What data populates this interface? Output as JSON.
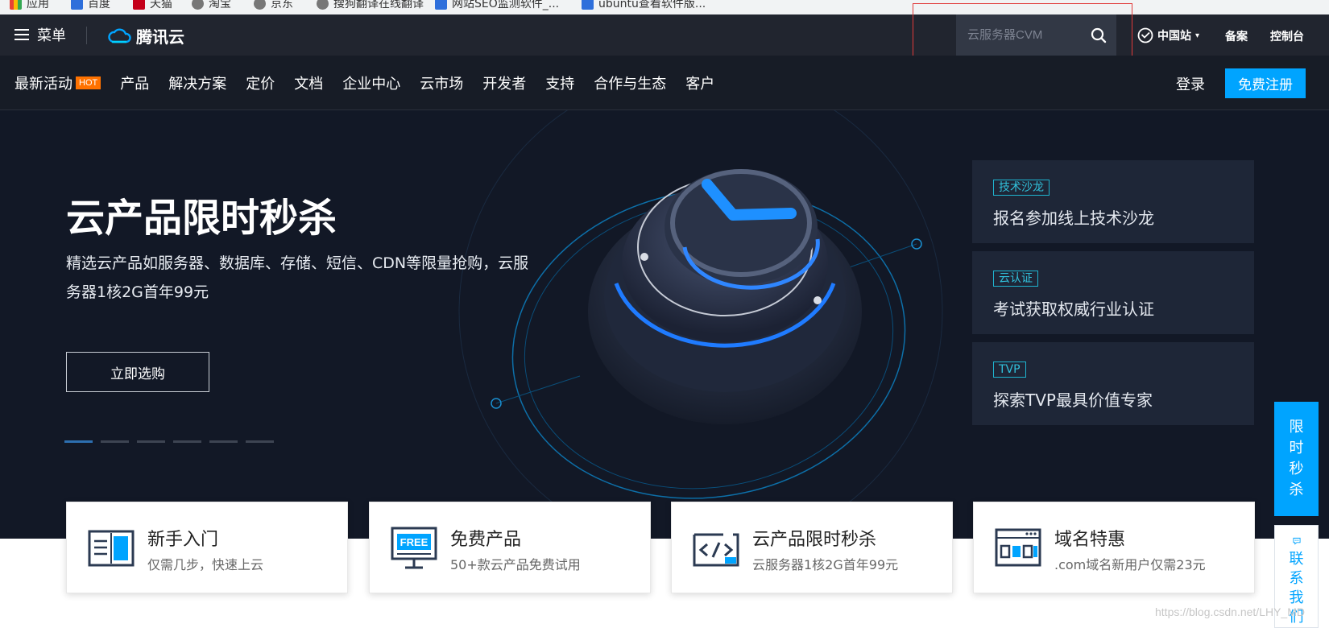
{
  "bookmarks": [
    "应用",
    "百度",
    "天猫",
    "淘宝",
    "京东",
    "搜狗翻译在线翻译",
    "网站SEO监测软件_...",
    "ubuntu查看软件版..."
  ],
  "topbar": {
    "menu_label": "菜单",
    "logo_text": "腾讯云",
    "search_placeholder": "云服务器CVM",
    "region": "中国站",
    "links": [
      "备案",
      "控制台"
    ]
  },
  "nav": {
    "items": [
      "最新活动",
      "产品",
      "解决方案",
      "定价",
      "文档",
      "企业中心",
      "云市场",
      "开发者",
      "支持",
      "合作与生态",
      "客户"
    ],
    "hot_badge": "HOT",
    "login": "登录",
    "register": "免费注册"
  },
  "hero": {
    "title": "云产品限时秒杀",
    "subtitle": "精选云产品如服务器、数据库、存储、短信、CDN等限量抢购，云服务器1核2G首年99元",
    "button": "立即选购",
    "slide_count": 6,
    "active_slide": 1
  },
  "promos": [
    {
      "tag": "技术沙龙",
      "text": "报名参加线上技术沙龙"
    },
    {
      "tag": "云认证",
      "text": "考试获取权威行业认证"
    },
    {
      "tag": "TVP",
      "text": "探索TVP最具价值专家"
    }
  ],
  "features": [
    {
      "title": "新手入门",
      "sub": "仅需几步，快速上云",
      "icon": "book-icon"
    },
    {
      "title": "免费产品",
      "sub": "50+款云产品免费试用",
      "icon": "free-monitor-icon"
    },
    {
      "title": "云产品限时秒杀",
      "sub": "云服务器1核2G首年99元",
      "icon": "code-icon"
    },
    {
      "title": "域名特惠",
      "sub": ".com域名新用户仅需23元",
      "icon": "domain-icon"
    }
  ],
  "side": {
    "flash": [
      "限",
      "时",
      "秒",
      "杀"
    ],
    "contact": [
      "联",
      "系",
      "我",
      "们"
    ]
  },
  "watermark": "https://blog.csdn.net/LHY_MD",
  "colors": {
    "accent": "#00a4ff",
    "hot": "#ff7200",
    "hero_bg": "#121826",
    "topbar_bg": "#21252f"
  }
}
